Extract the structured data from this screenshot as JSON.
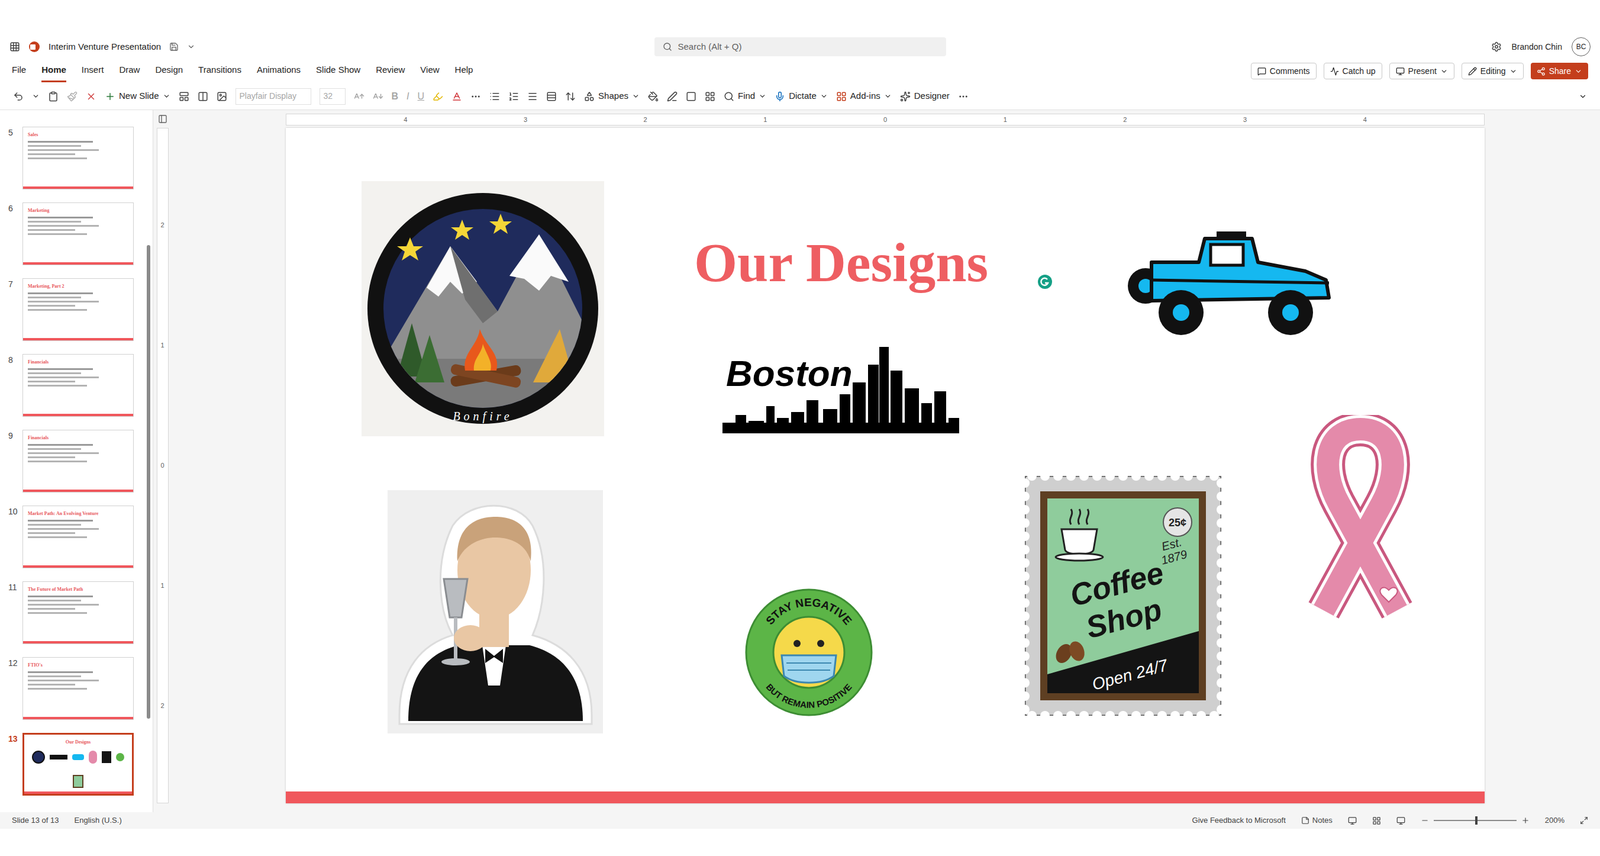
{
  "app": {
    "title": "Interim Venture Presentation",
    "search_placeholder": "Search (Alt + Q)",
    "user": "Brandon Chin",
    "initials": "BC"
  },
  "menu": [
    {
      "label": "File",
      "selected": false
    },
    {
      "label": "Home",
      "selected": true
    },
    {
      "label": "Insert",
      "selected": false
    },
    {
      "label": "Draw",
      "selected": false
    },
    {
      "label": "Design",
      "selected": false
    },
    {
      "label": "Transitions",
      "selected": false
    },
    {
      "label": "Animations",
      "selected": false
    },
    {
      "label": "Slide Show",
      "selected": false
    },
    {
      "label": "Review",
      "selected": false
    },
    {
      "label": "View",
      "selected": false
    },
    {
      "label": "Help",
      "selected": false
    }
  ],
  "menu_actions": [
    "Comments",
    "Catch up",
    "Present",
    "Editing",
    "Share"
  ],
  "toolbar": {
    "new_slide": "New Slide",
    "font": "Playfair Display",
    "font_size": "32",
    "format": [
      "B",
      "I",
      "U"
    ],
    "shapes": "Shapes",
    "find": "Find",
    "dictate": "Dictate",
    "addins": "Add-ins",
    "designer": "Designer"
  },
  "ruler": {
    "horizontal": [
      "4",
      "3",
      "2",
      "1",
      "0",
      "1",
      "2",
      "3",
      "4"
    ],
    "vertical": [
      "2",
      "1",
      "0",
      "1",
      "2"
    ]
  },
  "thumbnails": [
    {
      "number": "5",
      "title": "Sales",
      "selected": false
    },
    {
      "number": "6",
      "title": "Marketing",
      "selected": false
    },
    {
      "number": "7",
      "title": "Marketing, Part 2",
      "selected": false
    },
    {
      "number": "8",
      "title": "Financials",
      "selected": false
    },
    {
      "number": "9",
      "title": "Financials",
      "selected": false
    },
    {
      "number": "10",
      "title": "Market Path: An Evolving Venture",
      "selected": false
    },
    {
      "number": "11",
      "title": "The Future of Market Path",
      "selected": false
    },
    {
      "number": "12",
      "title": "FTIO's",
      "selected": false
    },
    {
      "number": "13",
      "title": "Our Designs",
      "selected": true
    }
  ],
  "slide": {
    "title": "Our Designs",
    "designs": [
      {
        "kind": "bonfire",
        "text": "Bonfire"
      },
      {
        "kind": "skyline",
        "text": "Boston"
      },
      {
        "kind": "jeep"
      },
      {
        "kind": "toast"
      },
      {
        "kind": "mask",
        "top": "STAY NEGATIVE",
        "bottom": "BUT REMAIN POSITIVE"
      },
      {
        "kind": "stamp",
        "price": "25¢",
        "est_lines": [
          "Est.",
          "1879"
        ],
        "name_lines": [
          "Coffee",
          "Shop"
        ],
        "hours": "Open 24/7"
      },
      {
        "kind": "ribbon"
      }
    ]
  },
  "status_bar": {
    "slide": "Slide 13 of 13",
    "language": "English (U.S.)",
    "feedback": "Give Feedback to Microsoft",
    "notes": "Notes",
    "zoom": "200%",
    "zoom_level": 0.5
  }
}
